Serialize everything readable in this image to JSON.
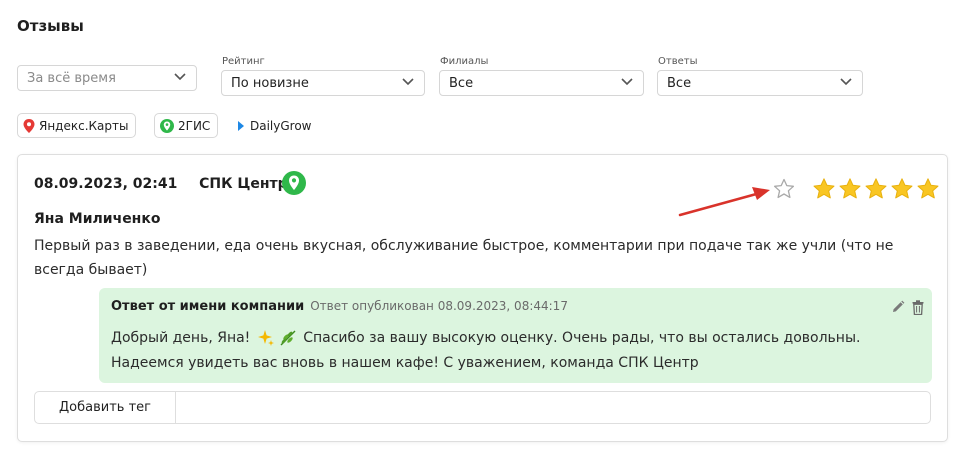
{
  "page": {
    "title": "Отзывы"
  },
  "filters": {
    "period": {
      "placeholder": "За всё время"
    },
    "rating": {
      "label": "Рейтинг",
      "value": "По новизне"
    },
    "branches": {
      "label": "Филиалы",
      "value": "Все"
    },
    "answers": {
      "label": "Ответы",
      "value": "Все"
    }
  },
  "sources": [
    {
      "label": "Яндекс.Карты",
      "icon": "map-pin-icon",
      "color": "#e53935"
    },
    {
      "label": "2ГИС",
      "icon": "2gis-icon",
      "color": "#2fb84a"
    },
    {
      "label": "DailyGrow",
      "icon": "chevron-right-icon",
      "color": "#1e88e5"
    }
  ],
  "review": {
    "datetime": "08.09.2023, 02:41",
    "branch": "СПК Центр",
    "author": "Яна Миличенко",
    "text": "Первый раз в заведении, еда очень вкусная, обслуживание быстрое, комментарии при подаче так же учли (что не всегда бывает)",
    "rating": 5,
    "rating_max": 5,
    "star_color": "#f9c623"
  },
  "reply": {
    "title": "Ответ от имени компании",
    "published": "Ответ опубликован 08.09.2023, 08:44:17",
    "text_part1": "Добрый день, Яна!",
    "text_part2": "Спасибо за вашу высокую оценку. Очень рады, что вы остались довольны. Надеемся увидеть вас вновь в нашем кафе! С уважением, команда СПК Центр",
    "background": "#dcf5df"
  },
  "tags": {
    "add_label": "Добавить тег"
  }
}
